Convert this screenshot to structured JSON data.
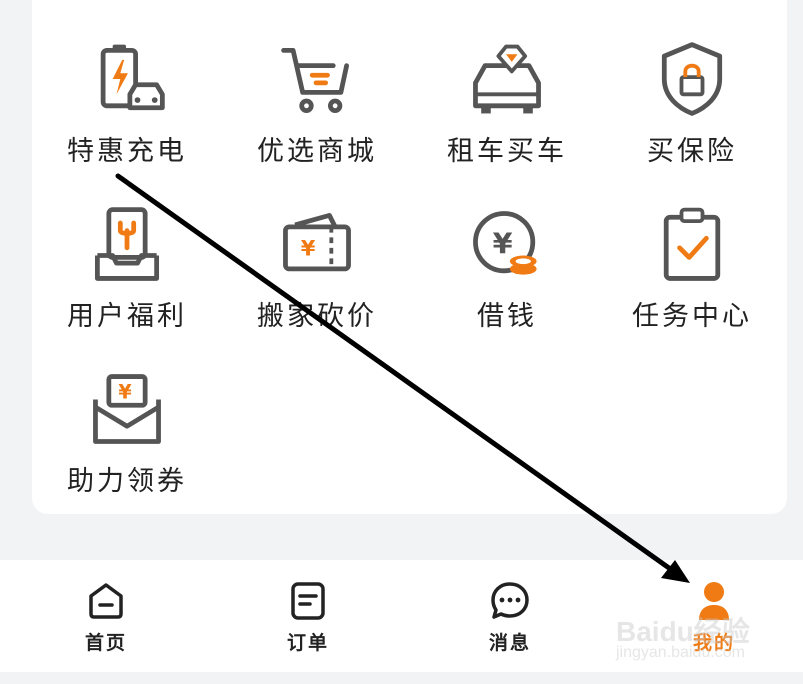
{
  "grid": {
    "items": [
      {
        "label": "特惠充电",
        "icon": "charging-car-icon"
      },
      {
        "label": "优选商城",
        "icon": "shopping-cart-icon"
      },
      {
        "label": "租车买车",
        "icon": "car-diamond-icon"
      },
      {
        "label": "买保险",
        "icon": "shield-lock-icon"
      },
      {
        "label": "用户福利",
        "icon": "gift-card-icon"
      },
      {
        "label": "搬家砍价",
        "icon": "wallet-ticket-icon"
      },
      {
        "label": "借钱",
        "icon": "yuan-coin-icon"
      },
      {
        "label": "任务中心",
        "icon": "clipboard-check-icon"
      },
      {
        "label": "助力领券",
        "icon": "coupon-envelope-icon"
      }
    ]
  },
  "tabbar": {
    "tabs": [
      {
        "label": "首页",
        "icon": "home-icon",
        "active": false
      },
      {
        "label": "订单",
        "icon": "order-doc-icon",
        "active": false
      },
      {
        "label": "消息",
        "icon": "chat-bubble-icon",
        "active": false
      },
      {
        "label": "我的",
        "icon": "user-profile-icon",
        "active": true
      }
    ]
  },
  "colors": {
    "accent": "#f07b14",
    "icon_stroke": "#555555",
    "text": "#222222",
    "background": "#f2f3f5"
  },
  "watermark": {
    "brand": "Baidu经验",
    "url": "jingyan.baidu.com"
  }
}
